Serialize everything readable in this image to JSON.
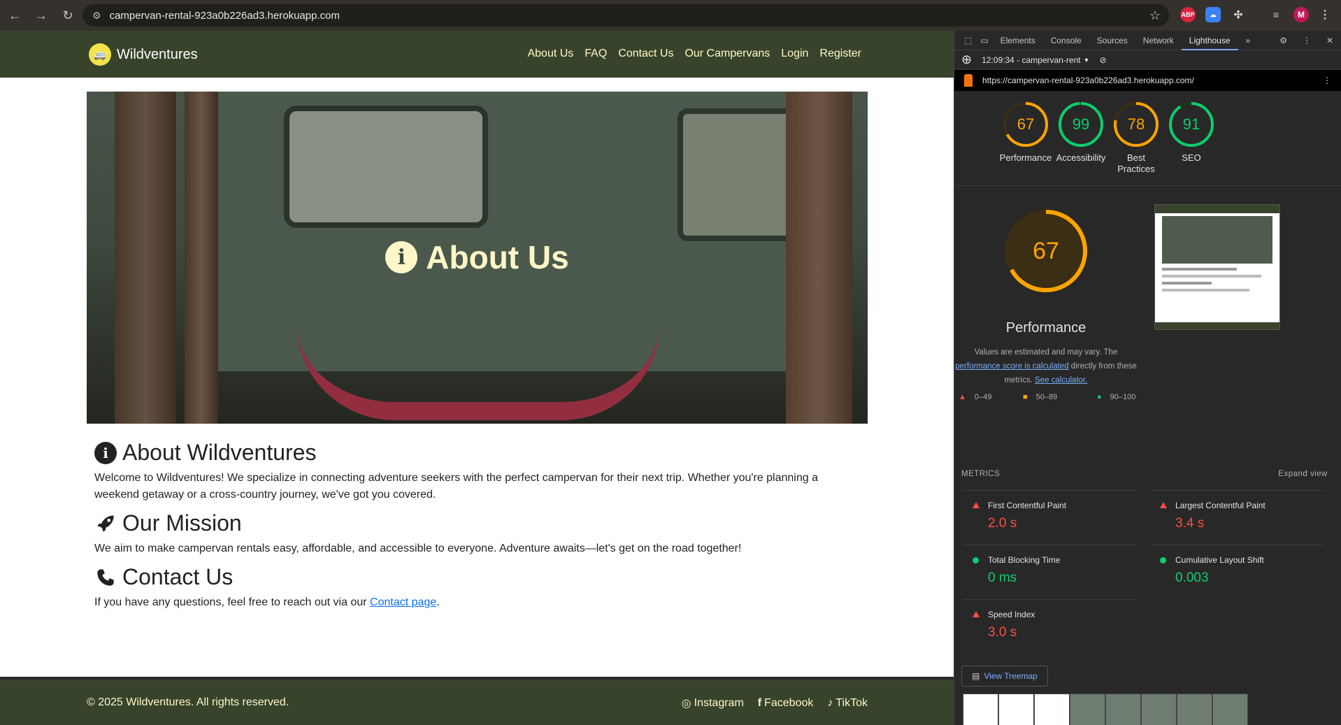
{
  "browser": {
    "url": "campervan-rental-923a0b226ad3.herokuapp.com",
    "profile_initial": "M",
    "ext_abp": "ABP"
  },
  "site": {
    "brand": "Wildventures",
    "nav": [
      "About Us",
      "FAQ",
      "Contact Us",
      "Our Campervans",
      "Login",
      "Register"
    ],
    "hero_title": "About Us",
    "sections": [
      {
        "title": "About Wildventures",
        "icon": "info-circle-icon",
        "text": "Welcome to Wildventures! We specialize in connecting adventure seekers with the perfect campervan for their next trip. Whether you're planning a weekend getaway or a cross-country journey, we've got you covered."
      },
      {
        "title": "Our Mission",
        "icon": "rocket-icon",
        "text": "We aim to make campervan rentals easy, affordable, and accessible to everyone. Adventure awaits—let's get on the road together!"
      },
      {
        "title": "Contact Us",
        "icon": "phone-icon",
        "text_before": "If you have any questions, feel free to reach out via our ",
        "link": "Contact page",
        "text_after": "."
      }
    ],
    "footer": {
      "copyright": "© 2025 Wildventures. All rights reserved.",
      "links": [
        "Instagram",
        "Facebook",
        "TikTok"
      ]
    }
  },
  "devtools": {
    "tabs": [
      "Elements",
      "Console",
      "Sources",
      "Network",
      "Lighthouse"
    ],
    "active_tab": "Lighthouse",
    "report_time": "12:09:34 - campervan-rent",
    "report_url": "https://campervan-rental-923a0b226ad3.herokuapp.com/",
    "scores": [
      {
        "label": "Performance",
        "value": 67,
        "color": "#ffa400"
      },
      {
        "label": "Accessibility",
        "value": 99,
        "color": "#0cce6b"
      },
      {
        "label": "Best Practices",
        "value": 78,
        "color": "#ffa400"
      },
      {
        "label": "SEO",
        "value": 91,
        "color": "#0cce6b"
      }
    ],
    "perf": {
      "score": 67,
      "label": "Performance",
      "desc_1": "Values are estimated and may vary. The",
      "desc_link_1": "performance score is calculated",
      "desc_2": "directly from these metrics.",
      "desc_link_2": "See calculator."
    },
    "legend": [
      "0–49",
      "50–89",
      "90–100"
    ],
    "metrics_title": "METRICS",
    "expand_view": "Expand view",
    "metrics": [
      {
        "name": "First Contentful Paint",
        "value": "2.0 s",
        "status": "fail",
        "color": "#ff4e42"
      },
      {
        "name": "Largest Contentful Paint",
        "value": "3.4 s",
        "status": "fail",
        "color": "#ff4e42"
      },
      {
        "name": "Total Blocking Time",
        "value": "0 ms",
        "status": "pass",
        "color": "#0cce6b"
      },
      {
        "name": "Cumulative Layout Shift",
        "value": "0.003",
        "status": "pass",
        "color": "#0cce6b"
      },
      {
        "name": "Speed Index",
        "value": "3.0 s",
        "status": "fail",
        "color": "#ff4e42"
      }
    ],
    "treemap_button": "View Treemap"
  }
}
